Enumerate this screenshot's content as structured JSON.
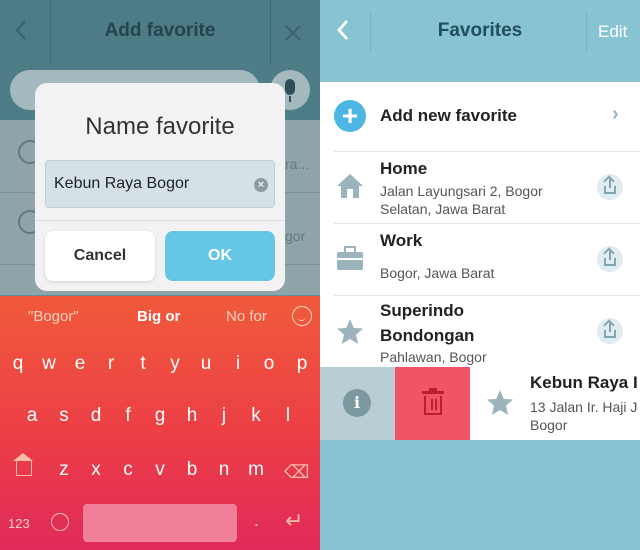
{
  "left": {
    "header": {
      "title": "Add favorite",
      "back_icon": "back-chevron-icon",
      "close_icon": "close-icon"
    },
    "background_hints": [
      "ra...",
      "gor"
    ],
    "dialog": {
      "title": "Name favorite",
      "input_value": "Kebun Raya Bogor",
      "cancel_label": "Cancel",
      "ok_label": "OK"
    },
    "keyboard": {
      "suggestions": [
        "\"Bogor\"",
        "Big or",
        "No for"
      ],
      "row1": [
        "q",
        "w",
        "e",
        "r",
        "t",
        "y",
        "u",
        "i",
        "o",
        "p"
      ],
      "row2": [
        "a",
        "s",
        "d",
        "f",
        "g",
        "h",
        "j",
        "k",
        "l"
      ],
      "row3": [
        "z",
        "x",
        "c",
        "v",
        "b",
        "n",
        "m"
      ],
      "mode_label": "123",
      "period": "."
    }
  },
  "right": {
    "header": {
      "title": "Favorites",
      "edit_label": "Edit",
      "back_icon": "back-chevron-icon"
    },
    "add_new_label": "Add new favorite",
    "favorites": [
      {
        "name": "Home",
        "address_line1": "Jalan Layungsari 2, Bogor",
        "address_line2": "Selatan, Jawa Barat",
        "icon": "home-icon"
      },
      {
        "name": "Work",
        "address_line1": "Bogor, Jawa Barat",
        "address_line2": "",
        "icon": "briefcase-icon"
      },
      {
        "name_line1": "Superindo",
        "name_line2": "Bondongan",
        "address_line1": "Pahlawan, Bogor",
        "icon": "star-icon"
      }
    ],
    "swiped_item": {
      "name": "Kebun Raya I",
      "address_line1": "13 Jalan Ir. Haji J",
      "address_line2": "Bogor",
      "icon": "star-icon"
    }
  },
  "colors": {
    "accent": "#66c6e5",
    "delete": "#ef5565",
    "keyboard": "#ec3e46"
  }
}
